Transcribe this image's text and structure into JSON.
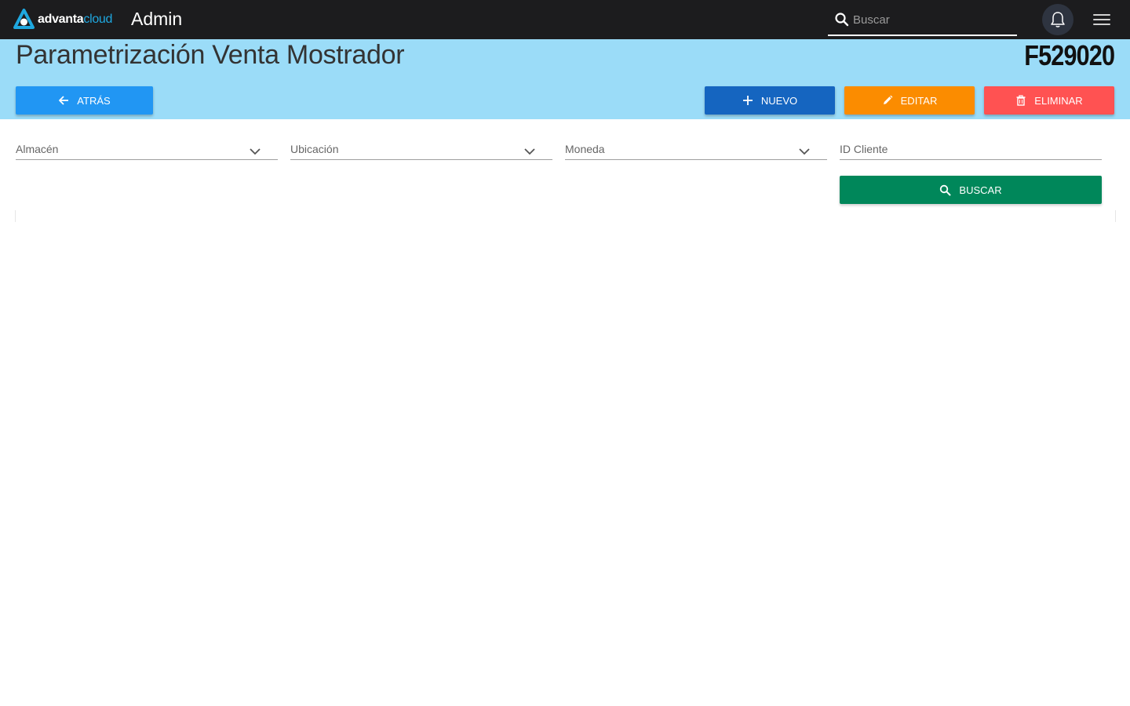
{
  "topbar": {
    "logo_word_main": "advanta",
    "logo_word_accent": "cloud",
    "app_title": "Admin",
    "search_placeholder": "Buscar"
  },
  "header": {
    "title": "Parametrización Venta Mostrador",
    "form_code": "F529020"
  },
  "actions": {
    "back_label": "ATRÁS",
    "new_label": "NUEVO",
    "edit_label": "EDITAR",
    "delete_label": "ELIMINAR"
  },
  "filters": {
    "warehouse_label": "Almacén",
    "location_label": "Ubicación",
    "currency_label": "Moneda",
    "client_id_label": "ID Cliente",
    "search_label": "BUSCAR"
  },
  "colors": {
    "topbar": "#1c1c1e",
    "band": "#9bdcf8",
    "back": "#2196f3",
    "new": "#1565c0",
    "edit": "#fb8c00",
    "delete": "#ff5252",
    "search": "#00875a"
  }
}
